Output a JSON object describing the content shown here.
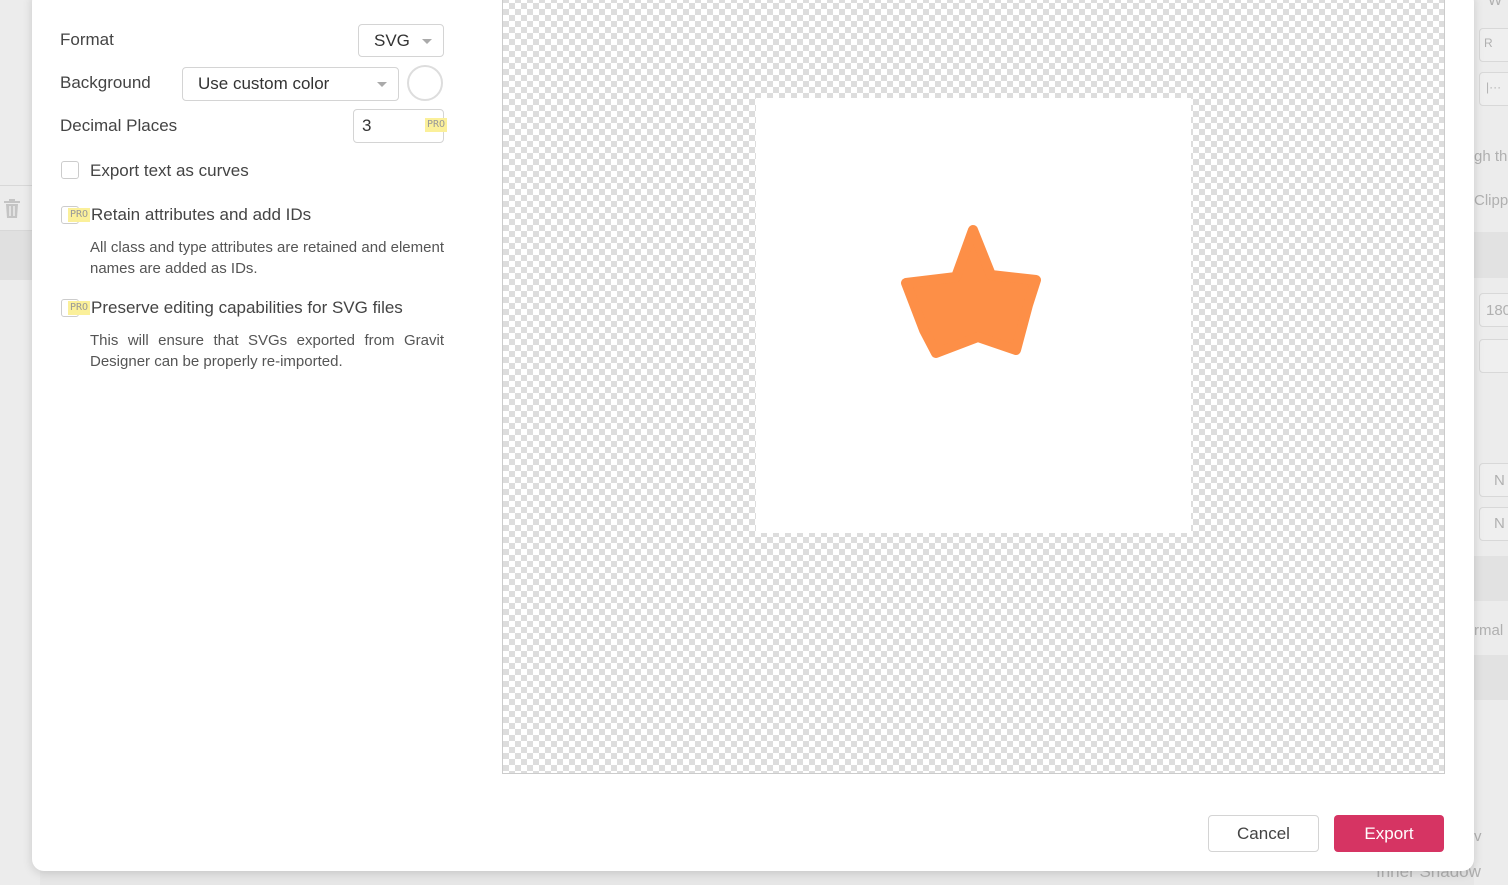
{
  "dialog": {
    "format": {
      "label": "Format",
      "value": "SVG"
    },
    "background": {
      "label": "Background",
      "value": "Use custom color"
    },
    "decimal_places": {
      "label": "Decimal Places",
      "value": "3",
      "badge": "PRO"
    },
    "export_text_as_curves": {
      "label": "Export text as curves",
      "checked": false
    },
    "retain_attributes": {
      "label": "Retain attributes and add IDs",
      "badge": "PRO",
      "description": "All class and type attributes are retained and element names are added as IDs."
    },
    "preserve_editing": {
      "label": "Preserve editing capabilities for SVG files",
      "badge": "PRO",
      "description": "This will ensure that SVGs exported from Gravit Designer can be properly re-imported."
    },
    "preview": {
      "shape": "star",
      "shape_color": "#FD8F47"
    },
    "cancel_label": "Cancel",
    "export_label": "Export",
    "accent": "#D63463"
  },
  "background_app": {
    "right_fragments": [
      "W",
      "R",
      "|···",
      "gh th",
      "Clipp",
      "180",
      "N",
      "N",
      "rmal",
      "v"
    ],
    "bottom_text": "Inner Shadow"
  }
}
